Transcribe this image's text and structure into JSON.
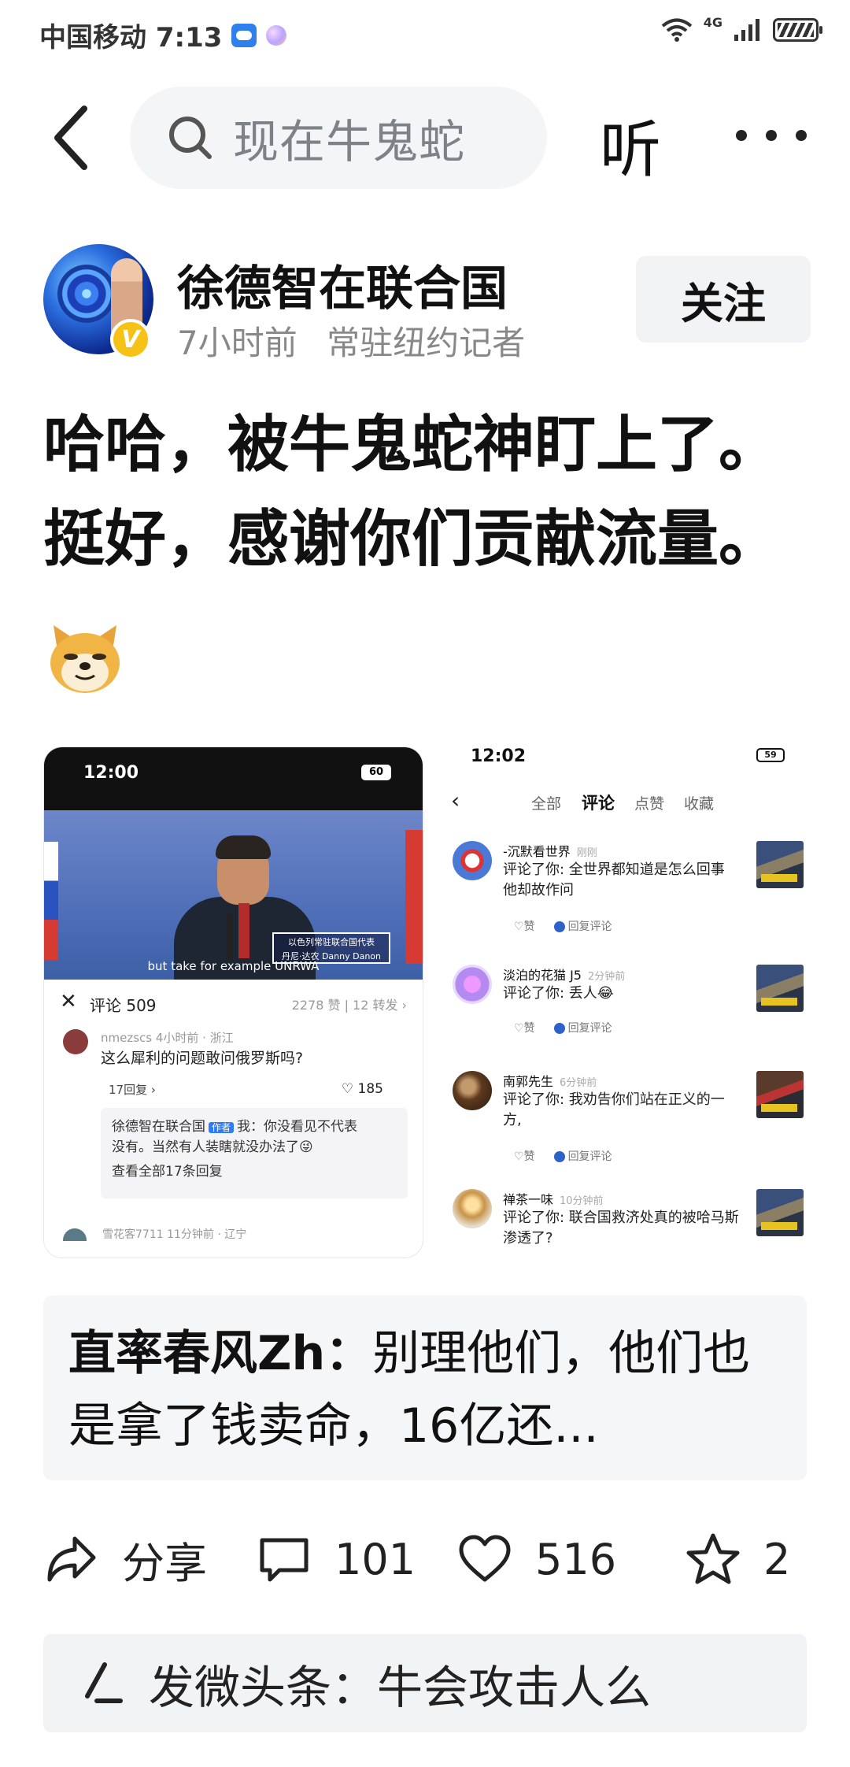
{
  "status_bar": {
    "carrier_time": "中国移动 7:13",
    "network": "4G"
  },
  "nav": {
    "search_placeholder": "现在牛鬼蛇",
    "listen_label": "听"
  },
  "author": {
    "name": "徐德智在联合国",
    "time": "7小时前",
    "title": "常驻纽约记者",
    "verified_badge": "V",
    "follow_label": "关注"
  },
  "post": {
    "line1": "哈哈，被牛鬼蛇神盯上了。",
    "line2": "挺好，感谢你们贡献流量。",
    "emoji": "doge-emoji"
  },
  "image_left": {
    "time": "12:00",
    "battery": "60",
    "overlay_text_1": "以色列常驻联合国代表",
    "overlay_text_2": "丹尼·达农 Danny Danon",
    "subtitle": "but take for example UNRWA",
    "comments_title": "评论 509",
    "stats": "2278 赞 | 12 转发 ›",
    "comment_user": "nmezscs  4小时前 · 浙江",
    "comment_text": "这么犀利的问题敢问俄罗斯吗?",
    "comment_replies": "17回复 ›",
    "comment_likes": "♡ 185",
    "reply_author": "徐德智在联合国",
    "reply_tag": "作者",
    "reply_text_1": "我：你没看见不代表",
    "reply_text_2": "没有。当然有人装瞎就没办法了😜",
    "reply_more": "查看全部17条回复",
    "next_user": "雪花客7711  11分钟前 · 辽宁"
  },
  "image_right": {
    "time": "12:02",
    "battery": "59",
    "tabs": [
      "全部",
      "评论",
      "点赞",
      "收藏"
    ],
    "notifications": [
      {
        "name": "-沉默看世界",
        "time": "刚刚",
        "text": "评论了你: 全世界都知道是怎么回事 他却故作问",
        "like": "♡赞",
        "reply": "回复评论"
      },
      {
        "name": "淡泊的花猫 J5",
        "time": "2分钟前",
        "text": "评论了你: 丢人😂",
        "like": "♡赞",
        "reply": "回复评论"
      },
      {
        "name": "南郭先生",
        "time": "6分钟前",
        "text": "评论了你: 我劝告你们站在正义的一方,",
        "like": "♡赞",
        "reply": "回复评论"
      },
      {
        "name": "禅茶一味",
        "time": "10分钟前",
        "text": "评论了你: 联合国救济处真的被哈马斯渗透了?",
        "like": "",
        "reply": ""
      }
    ]
  },
  "hot_comment": {
    "author": "直率春风Zh：",
    "text": "别理他们，他们也是拿了钱卖命，16亿还..."
  },
  "actions": {
    "share_label": "分享",
    "comments_count": "101",
    "likes_count": "516",
    "favorites_count": "2"
  },
  "input": {
    "placeholder": "发微头条：牛会攻击人么"
  }
}
